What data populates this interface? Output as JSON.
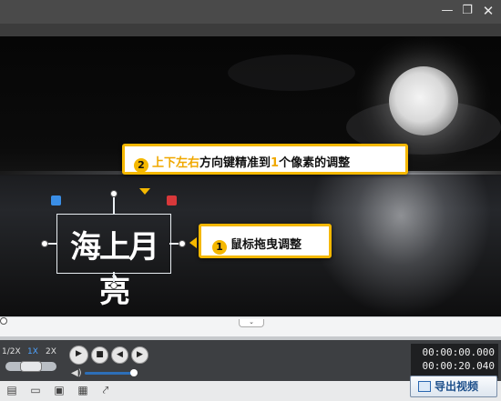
{
  "window": {
    "minimize_icon": "minimize-icon",
    "restore_icon": "restore-icon",
    "close_icon": "close-icon"
  },
  "canvas": {
    "title_text": "海上月亮",
    "callout_top": {
      "number": "2",
      "highlight": "上下左右",
      "text": "方向键精准到",
      "highlight_num": "1",
      "text_end": "个像素的调整"
    },
    "callout_side": {
      "number": "1",
      "text": "鼠标拖曳调整"
    }
  },
  "playback": {
    "speeds": [
      "1/2X",
      "1X",
      "2X"
    ],
    "selected_speed": "1X",
    "current_time": "00:00:00.000",
    "total_time": "00:00:20.040",
    "volume_level": 0.85
  },
  "toolbar": {
    "export_label": "导出视频",
    "icons": [
      "new-project-icon",
      "open-folder-icon",
      "save-icon",
      "save-as-icon",
      "share-icon"
    ]
  },
  "colors": {
    "accent": "#f5b800",
    "link": "#1c4e8a"
  }
}
